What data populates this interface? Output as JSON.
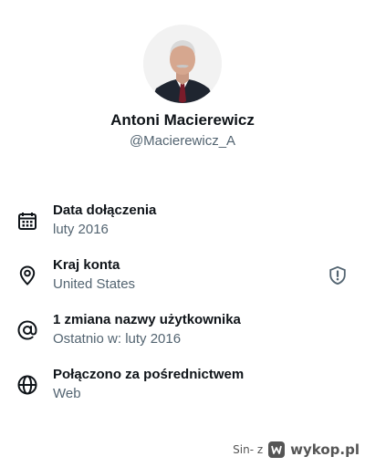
{
  "profile": {
    "name": "Antoni Macierewicz",
    "handle": "@Macierewicz_A"
  },
  "rows": [
    {
      "icon": "calendar-icon",
      "title": "Data dołączenia",
      "value": "luty 2016"
    },
    {
      "icon": "location-pin-icon",
      "title": "Kraj konta",
      "value": "United States"
    },
    {
      "icon": "at-sign-icon",
      "title": "1 zmiana nazwy użytkownika",
      "value": "Ostatnio w: luty 2016"
    },
    {
      "icon": "globe-icon",
      "title": "Połączono za pośrednictwem",
      "value": "Web"
    }
  ],
  "row_extras": {
    "country_badge_icon": "shield-exclamation-icon"
  },
  "watermark": {
    "user": "Sin- z",
    "logo_icon": "wykop-logo-icon",
    "site": "wykop.pl"
  },
  "colors": {
    "text_primary": "#0f1419",
    "text_secondary": "#536471"
  }
}
